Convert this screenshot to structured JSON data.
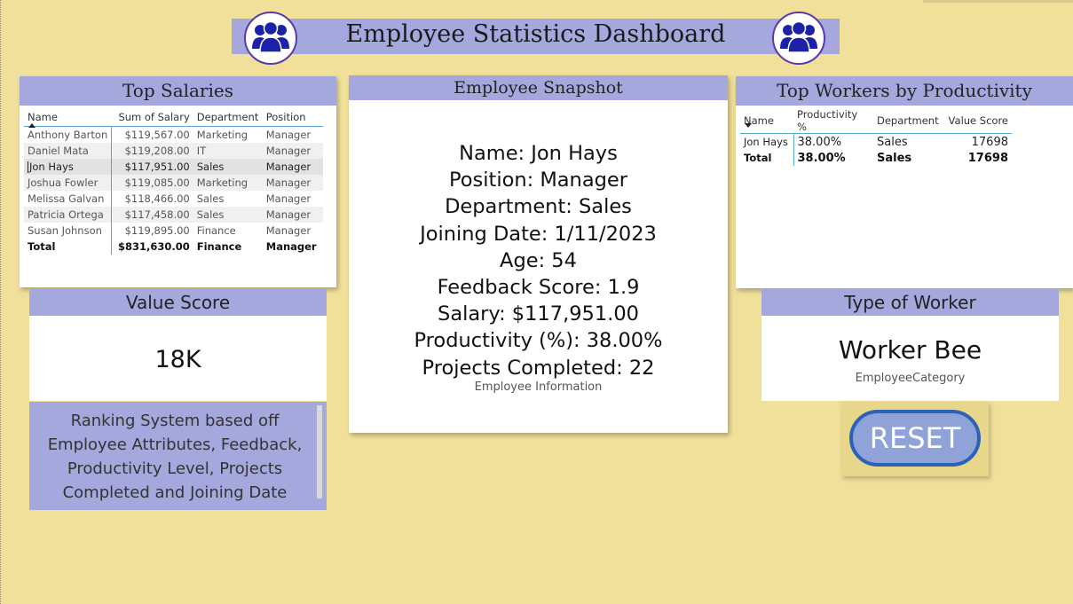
{
  "header": {
    "title": "Employee Statistics Dashboard",
    "icon": "people-group-icon"
  },
  "top_salaries": {
    "title": "Top Salaries",
    "columns": [
      "Name",
      "Sum of Salary",
      "Department",
      "Position"
    ],
    "rows": [
      [
        "Anthony Barton",
        "$119,567.00",
        "Marketing",
        "Manager"
      ],
      [
        "Daniel Mata",
        "$119,208.00",
        "IT",
        "Manager"
      ],
      [
        "Jon Hays",
        "$117,951.00",
        "Sales",
        "Manager"
      ],
      [
        "Joshua Fowler",
        "$119,085.00",
        "Marketing",
        "Manager"
      ],
      [
        "Melissa Galvan",
        "$118,466.00",
        "Sales",
        "Manager"
      ],
      [
        "Patricia Ortega",
        "$117,458.00",
        "Sales",
        "Manager"
      ],
      [
        "Susan Johnson",
        "$119,895.00",
        "Finance",
        "Manager"
      ]
    ],
    "total": [
      "Total",
      "$831,630.00",
      "Finance",
      "Manager"
    ]
  },
  "snapshot": {
    "title": "Employee Snapshot",
    "lines": [
      "Name: Jon Hays",
      "Position: Manager",
      "Department: Sales",
      "Joining Date: 1/11/2023",
      "Age: 54",
      "Feedback Score: 1.9",
      "Salary: $117,951.00",
      "Productivity (%): 38.00%",
      "Projects Completed: 22"
    ],
    "caption": "Employee Information"
  },
  "productivity": {
    "title": "Top Workers by Productivity",
    "columns": [
      "Name",
      "Productivity %",
      "Department",
      "Value Score"
    ],
    "rows": [
      [
        "Jon Hays",
        "38.00%",
        "Sales",
        "17698"
      ]
    ],
    "total": [
      "Total",
      "38.00%",
      "Sales",
      "17698"
    ]
  },
  "value_score": {
    "title": "Value Score",
    "value": "18K"
  },
  "ranking": {
    "text": "Ranking System based off Employee Attributes, Feedback, Productivity Level, Projects Completed and Joining Date"
  },
  "worker_type": {
    "title": "Type of Worker",
    "value": "Worker Bee",
    "label": "EmployeeCategory"
  },
  "reset": {
    "label": "RESET"
  },
  "colors": {
    "background": "#f0e09a",
    "header_band": "#a5a8dc",
    "icon": "#1c22a8",
    "reset_border": "#2a62b8",
    "reset_fill": "#8fa3d8"
  }
}
